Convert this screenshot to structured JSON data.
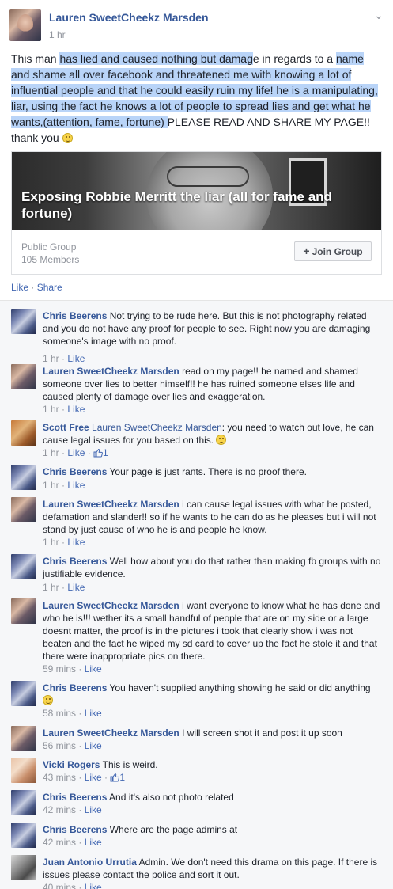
{
  "post": {
    "author": "Lauren SweetCheekz Marsden",
    "time": "1 hr",
    "body": {
      "part1": "This man ",
      "hl1": "has lied and caused nothing but damag",
      "part2": "e in regards to a ",
      "hl2": "name and shame all over facebook and threatened me with knowing a lot of influential people and that he could easily ruin my life! he is a manipulating, liar, using the fact he knows a lot of people to spread lies and get what he wants,(attention, fame, fortune) ",
      "part3": "PLEASE READ AND SHARE MY PAGE!! thank you"
    },
    "card": {
      "title": "Exposing Robbie Merritt the liar (all for fame and fortune)",
      "type": "Public Group",
      "members": "105 Members",
      "join_label": "Join Group"
    },
    "actions": {
      "like": "Like",
      "share": "Share",
      "sep": " · "
    }
  },
  "comments": [
    {
      "author": "Chris Beerens",
      "text": "Not trying to be rude here. But this is not photography related and you do not have any proof for people to see. Right now you are damaging someone's image with no proof.",
      "time": "1 hr",
      "like": "Like"
    },
    {
      "author": "Lauren SweetCheekz Marsden",
      "text": "read on my page!! he named and shamed someone over lies to better himself!! he has ruined someone elses life and caused plenty of damage over lies and exaggeration.",
      "time": "1 hr",
      "like": "Like"
    },
    {
      "author": "Scott Free",
      "mention": "Lauren SweetCheekz Marsden",
      "text": ": you need to watch out love, he can cause legal issues for you based on this.",
      "time": "1 hr",
      "like": "Like",
      "likes": "1"
    },
    {
      "author": "Chris Beerens",
      "text": "Your page is just rants. There is no proof there.",
      "time": "1 hr",
      "like": "Like"
    },
    {
      "author": "Lauren SweetCheekz Marsden",
      "text": "i can cause legal issues with what he posted, defamation and slander!! so if he wants to he can do as he pleases but i will not stand by just cause of who he is and people he know.",
      "time": "1 hr",
      "like": "Like"
    },
    {
      "author": "Chris Beerens",
      "text": "Well how about you do that rather than making fb groups with no justifiable evidence.",
      "time": "1 hr",
      "like": "Like"
    },
    {
      "author": "Lauren SweetCheekz Marsden",
      "text": "i want everyone to know what he has done and who he is!!! wether its a small handful of people that are on my side or a large doesnt matter, the proof is in the pictures i took that clearly show i was not beaten and the fact he wiped my sd card to cover up the fact he stole it and that there were inappropriate pics on there.",
      "time": "59 mins",
      "like": "Like"
    },
    {
      "author": "Chris Beerens",
      "text": "You haven't supplied anything showing he said or did anything",
      "time": "58 mins",
      "like": "Like"
    },
    {
      "author": "Lauren SweetCheekz Marsden",
      "text": "I will screen shot it and post it up soon",
      "time": "56 mins",
      "like": "Like"
    },
    {
      "author": "Vicki Rogers",
      "text": "This is weird.",
      "time": "43 mins",
      "like": "Like",
      "likes": "1"
    },
    {
      "author": "Chris Beerens",
      "text": "And it's also not photo related",
      "time": "42 mins",
      "like": "Like"
    },
    {
      "author": "Chris Beerens",
      "text": "Where are the page admins at",
      "time": "42 mins",
      "like": "Like"
    },
    {
      "author": "Juan Antonio Urrutia",
      "text": "Admin. We don't need this drama on this page. If there is issues please contact the police and sort it out.",
      "time": "40 mins",
      "like": "Like"
    }
  ],
  "meta_sep": " · ",
  "icons": [
    "chevron-down-icon",
    "smile-emoji-icon",
    "sad-emoji-icon",
    "thumbs-up-icon",
    "plus-icon"
  ],
  "colors": {
    "link": "#365899",
    "action": "#4267b2",
    "muted": "#90949c",
    "highlight": "#b9d4f8",
    "comment_bg": "#f6f7f9"
  }
}
